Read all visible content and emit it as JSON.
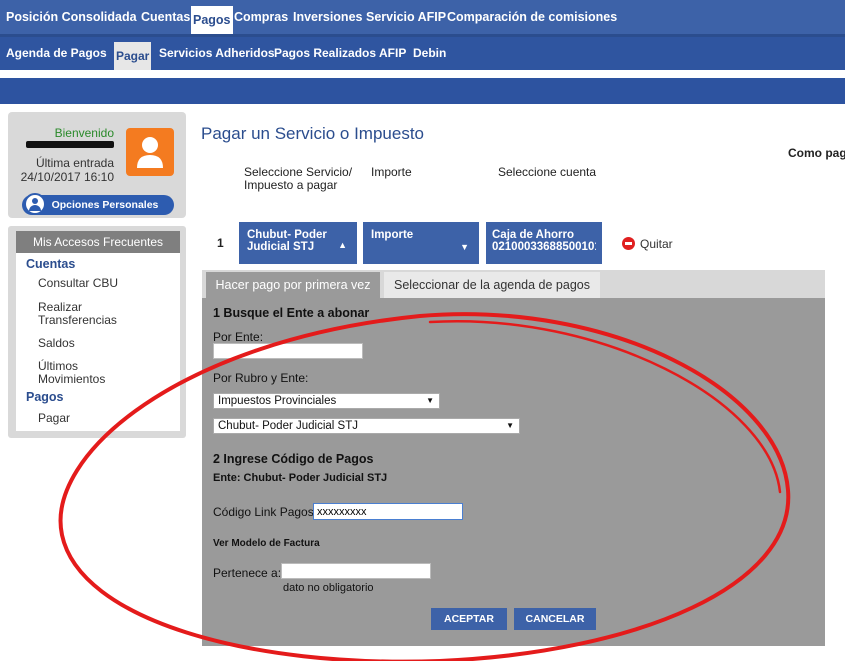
{
  "topnav": {
    "items": [
      "Posición Consolidada",
      "Cuentas",
      "Pagos",
      "Compras",
      "Inversiones",
      "Servicio AFIP",
      "Comparación de comisiones"
    ]
  },
  "subnav": {
    "items": [
      "Agenda de Pagos",
      "Pagar",
      "Servicios Adheridos",
      "Pagos Realizados",
      "AFIP",
      "Debin"
    ]
  },
  "sidebar": {
    "welcome": "Bienvenido",
    "last_entry_label": "Última entrada",
    "last_entry_date": "24/10/2017 16:10",
    "personal_options": "Opciones Personales",
    "favorites_title": "Mis Accesos Frecuentes",
    "sections": [
      {
        "title": "Cuentas",
        "links": [
          "Consultar CBU",
          "Realizar Transferencias",
          "Saldos",
          "Últimos Movimientos"
        ]
      },
      {
        "title": "Pagos",
        "links": [
          "Pagar"
        ]
      }
    ]
  },
  "main": {
    "title": "Pagar un Servicio o Impuesto",
    "how_to_pay": "Como paga",
    "steps": {
      "label_service": "Seleccione Servicio/ Impuesto a pagar",
      "label_amount": "Importe",
      "label_account": "Seleccione cuenta",
      "number": "1",
      "service_value": "Chubut- Poder Judicial STJ",
      "amount_value": "Importe",
      "account_type": "Caja de Ahorro",
      "account_number": "021000336885001",
      "account_number_tail": "01",
      "remove": "Quitar"
    },
    "tabs": {
      "first_time": "Hacer pago por primera vez",
      "agenda": "Seleccionar de la agenda de pagos"
    },
    "form": {
      "section1_title": "1 Busque el Ente a abonar",
      "by_entity_label": "Por Ente:",
      "by_entity_value": "",
      "by_category_label": "Por Rubro y Ente:",
      "category_selected": "Impuestos Provinciales",
      "entity_selected": "Chubut- Poder Judicial STJ",
      "section2_title": "2 Ingrese Código de Pagos",
      "entity_info": "Ente: Chubut- Poder Judicial STJ",
      "code_label": "Código Link Pagos",
      "code_value": "xxxxxxxxx",
      "invoice_model_link": "Ver Modelo de Factura",
      "belongs_label": "Pertenece a:",
      "belongs_value": "",
      "optional_note": "dato no obligatorio",
      "accept": "ACEPTAR",
      "cancel": "CANCELAR"
    }
  },
  "colors": {
    "nav_blue": "#3d62a8",
    "panel_gray": "#9a9a9a",
    "avatar_orange": "#f47b20",
    "annotation_red": "#e41b1b"
  }
}
